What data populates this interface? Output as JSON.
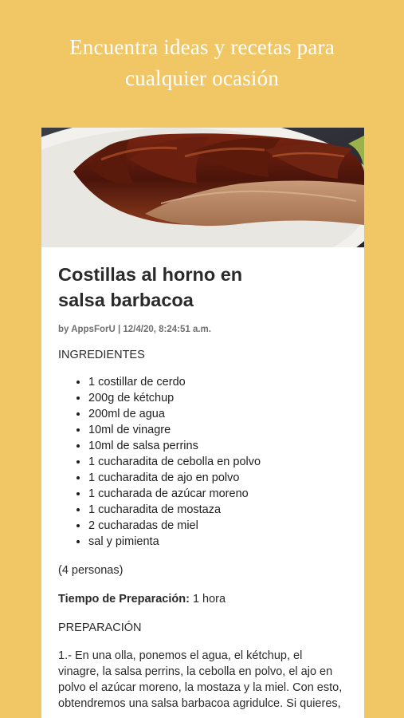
{
  "headline": {
    "line1": "Encuentra ideas y recetas para",
    "line2": "cualquier ocasión"
  },
  "recipe": {
    "image_subject": "costillas-barbacoa-photo",
    "title_line1": "Costillas al horno en",
    "title_line2": "salsa barbacoa",
    "byline": "by AppsForU | 12/4/20, 8:24:51 a.m.",
    "ingredients_heading": "INGREDIENTES",
    "ingredients": [
      "1 costillar de cerdo",
      "200g de kétchup",
      "200ml de agua",
      "10ml de vinagre",
      "10ml de salsa perrins",
      "1 cucharadita de cebolla en polvo",
      "1 cucharadita de ajo en polvo",
      "1 cucharada de azúcar moreno",
      "1 cucharadita de mostaza",
      "2 cucharadas de miel",
      "sal y pimienta"
    ],
    "servings": "(4 personas)",
    "prep_time_label": "Tiempo de Preparación:",
    "prep_time_value": "1 hora",
    "preparation_heading": "PREPARACIÓN",
    "preparation_lines": [
      "1.- En una olla, ponemos el agua, el kétchup, el",
      "vinagre, la salsa perrins, la cebolla en polvo, el ajo en",
      "polvo el azúcar moreno, la mostaza y la miel. Con esto,",
      "obtendremos una salsa barbacoa agridulce. Si quieres,"
    ]
  },
  "colors": {
    "background": "#f1c765",
    "card": "#ffffff",
    "text": "#2a2a2a"
  }
}
